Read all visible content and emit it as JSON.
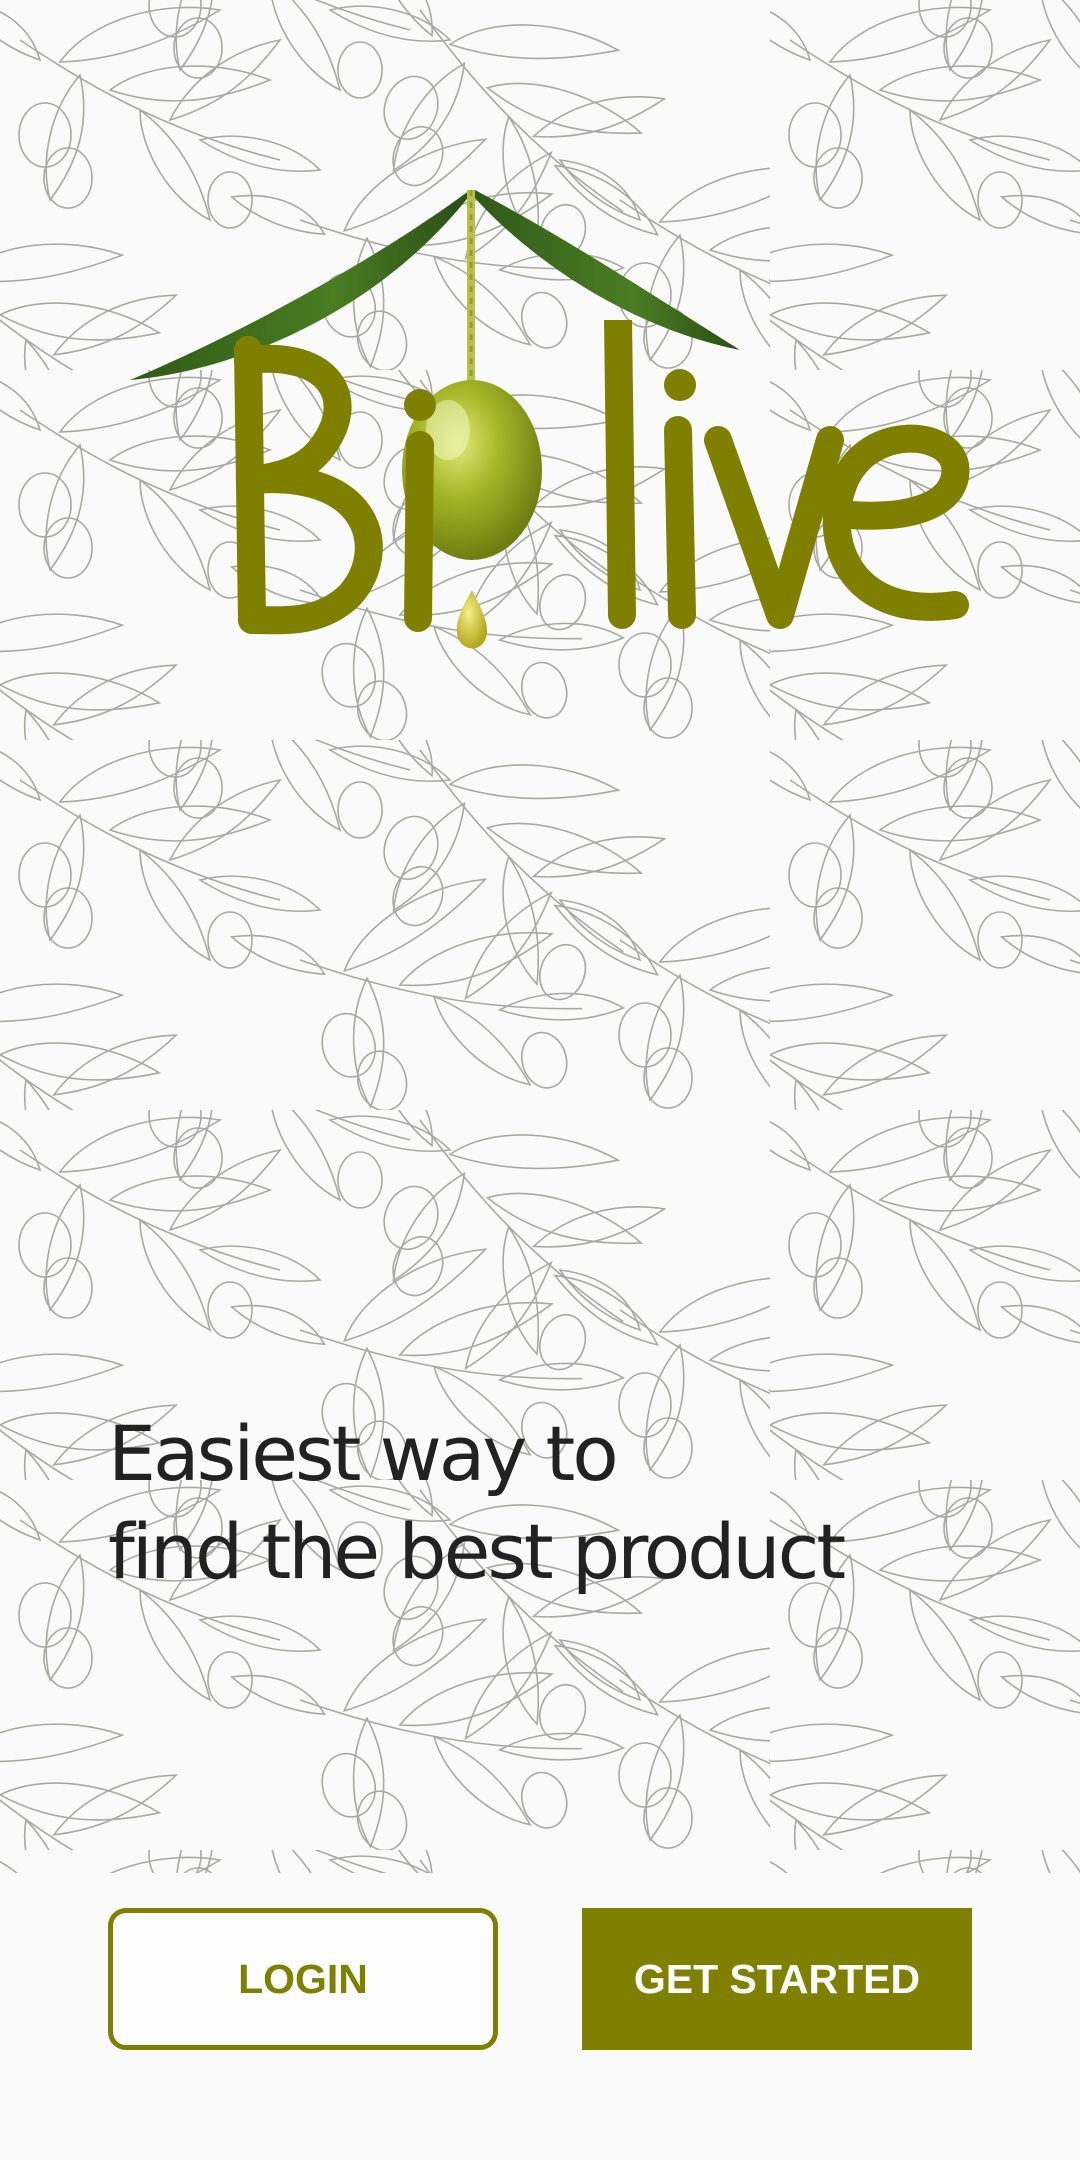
{
  "brand": {
    "name": "Biolive",
    "color": "#808000"
  },
  "tagline": {
    "line1": "Easiest way to",
    "line2": "find the best product"
  },
  "actions": {
    "login_label": "LOGIN",
    "get_started_label": "GET STARTED"
  },
  "background": {
    "pattern": "olive-branch-sketch",
    "color": "#fafafa"
  }
}
